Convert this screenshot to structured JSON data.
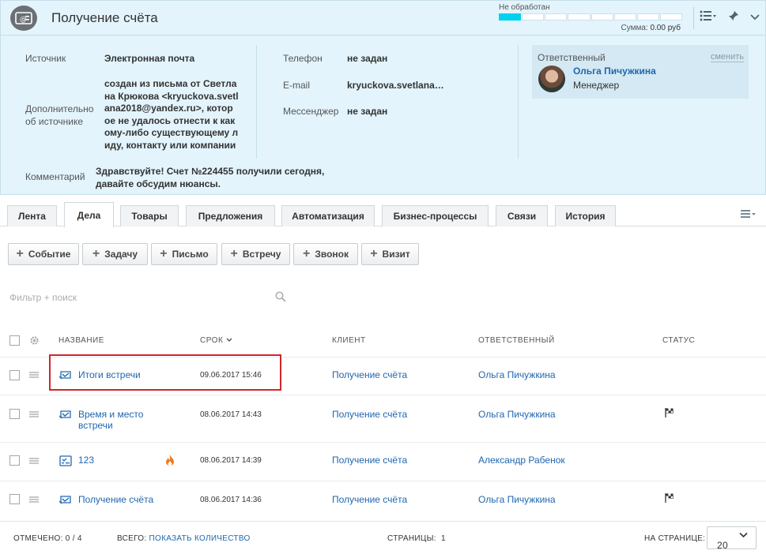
{
  "header": {
    "title": "Получение счёта",
    "status": "Не обработан",
    "progress_steps": 8,
    "progress_done": 1,
    "sum_label": "Сумма:",
    "sum_value": "0.00 руб",
    "accent_color": "#00d1ee"
  },
  "info": {
    "source_label": "Источник",
    "source_value": "Электронная почта",
    "extra_label_1": "Дополнительно",
    "extra_label_2": "об источнике",
    "extra_lines": [
      "создан из письма от Светла",
      "на Крюкова <kryuckova.svetl",
      "ana2018@yandex.ru>, котор",
      "ое не удалось отнести к как",
      "ому-либо существующему л",
      "иду, контакту или компании"
    ],
    "comment_label": "Комментарий",
    "comment_lines": [
      "Здравствуйте! Счет №224455 получили сегодня,",
      "давайте обсудим нюансы."
    ],
    "phone_label": "Телефон",
    "phone_value": "не задан",
    "email_label": "E-mail",
    "email_value": "kryuckova.svetlana…",
    "messenger_label": "Мессенджер",
    "messenger_value": "не задан"
  },
  "responsible": {
    "caption": "Ответственный",
    "change": "сменить",
    "name": "Ольга Пичужкина",
    "position": "Менеджер"
  },
  "tabs": [
    {
      "label": "Лента"
    },
    {
      "label": "Дела"
    },
    {
      "label": "Товары"
    },
    {
      "label": "Предложения"
    },
    {
      "label": "Автоматизация"
    },
    {
      "label": "Бизнес-процессы"
    },
    {
      "label": "Связи"
    },
    {
      "label": "История"
    }
  ],
  "actions": [
    {
      "label": "Событие"
    },
    {
      "label": "Задачу"
    },
    {
      "label": "Письмо"
    },
    {
      "label": "Встречу"
    },
    {
      "label": "Звонок"
    },
    {
      "label": "Визит"
    }
  ],
  "filter": {
    "placeholder": "Фильтр + поиск"
  },
  "grid": {
    "columns": {
      "name": "НАЗВАНИЕ",
      "deadline": "СРОК",
      "client": "КЛИЕНТ",
      "responsible": "ОТВЕТСТВЕННЫЙ",
      "status": "СТАТУС"
    },
    "rows": [
      {
        "name": "Итоги встречи",
        "date": "09.06.2017 15:46",
        "client": "Получение счёта",
        "responsible": "Ольга Пичужкина",
        "icon": "meeting-icon",
        "status": ""
      },
      {
        "name_1": "Время и место",
        "name_2": "встречи",
        "date": "08.06.2017 14:43",
        "client": "Получение счёта",
        "responsible": "Ольга Пичужкина",
        "icon": "meeting-icon",
        "status": "flag"
      },
      {
        "name": "123",
        "date": "08.06.2017 14:39",
        "client": "Получение счёта",
        "responsible": "Александр Рабенок",
        "icon": "task-icon",
        "status": "",
        "important": true
      },
      {
        "name": "Получение счёта",
        "date": "08.06.2017 14:36",
        "client": "Получение счёта",
        "responsible": "Ольга Пичужкина",
        "icon": "meeting-icon",
        "status": "flag"
      }
    ]
  },
  "footer": {
    "selected_label": "ОТМЕЧЕНО:",
    "selected_value": "0 / 4",
    "total_label": "ВСЕГО:",
    "total_link": "ПОКАЗАТЬ КОЛИЧЕСТВО",
    "pages_label": "СТРАНИЦЫ:",
    "pages_value": "1",
    "per_page_label": "НА СТРАНИЦЕ:",
    "per_page_value": "20"
  }
}
